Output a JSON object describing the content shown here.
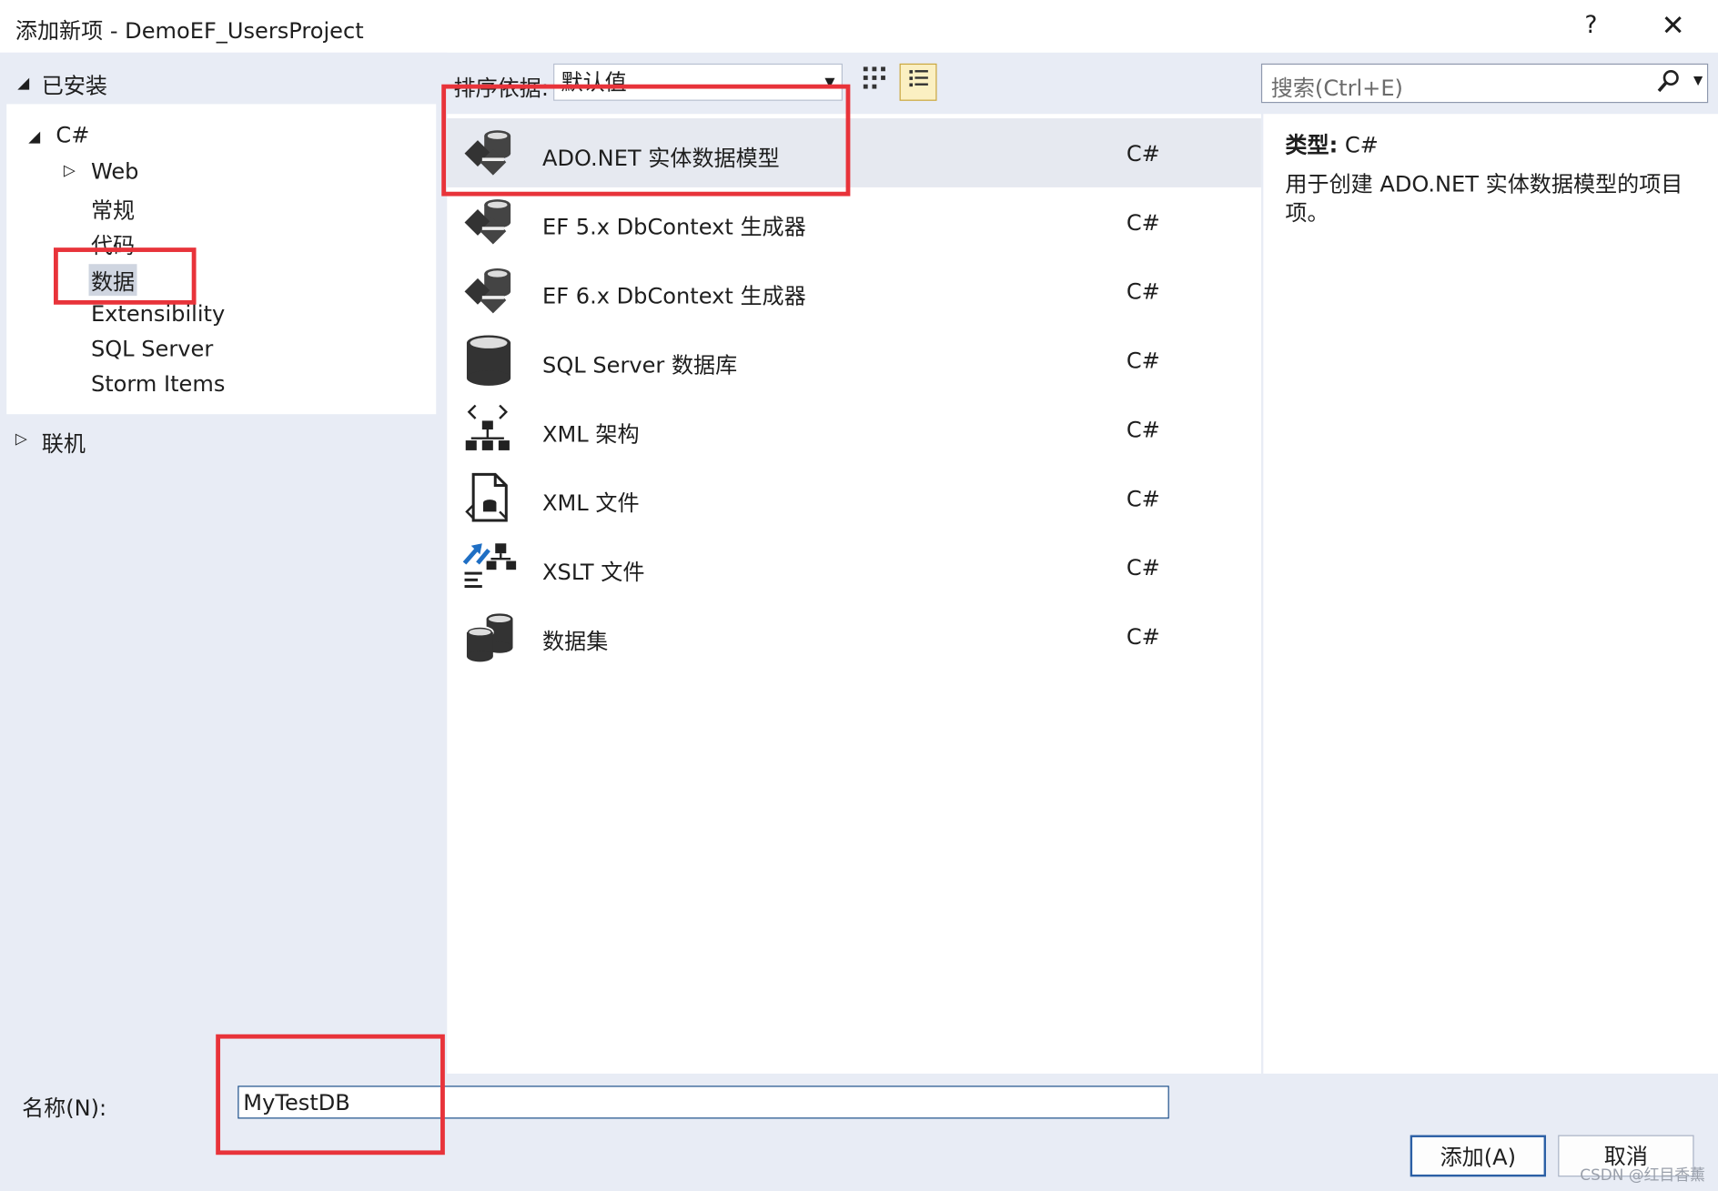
{
  "window": {
    "title": "添加新项 - DemoEF_UsersProject",
    "help": "?",
    "close": "✕"
  },
  "tree": {
    "installed": "已安装",
    "csharp": "C#",
    "web": "Web",
    "general": "常规",
    "code": "代码",
    "data": "数据",
    "extensibility": "Extensibility",
    "sqlserver": "SQL Server",
    "storm": "Storm Items",
    "online": "联机"
  },
  "toolbar": {
    "sort_label": "排序依据:",
    "sort_value": "默认值"
  },
  "search": {
    "placeholder": "搜索(Ctrl+E)"
  },
  "templates": [
    {
      "name": "ADO.NET 实体数据模型",
      "lang": "C#",
      "icon": "entity-model-icon"
    },
    {
      "name": "EF 5.x DbContext 生成器",
      "lang": "C#",
      "icon": "entity-model-icon"
    },
    {
      "name": "EF 6.x DbContext 生成器",
      "lang": "C#",
      "icon": "entity-model-icon"
    },
    {
      "name": "SQL Server 数据库",
      "lang": "C#",
      "icon": "database-icon"
    },
    {
      "name": "XML 架构",
      "lang": "C#",
      "icon": "xml-schema-icon"
    },
    {
      "name": "XML 文件",
      "lang": "C#",
      "icon": "xml-file-icon"
    },
    {
      "name": "XSLT 文件",
      "lang": "C#",
      "icon": "xslt-file-icon"
    },
    {
      "name": "数据集",
      "lang": "C#",
      "icon": "dataset-icon"
    }
  ],
  "detail": {
    "type_label": "类型:",
    "type_value": "C#",
    "description": "用于创建 ADO.NET 实体数据模型的项目项。"
  },
  "footer": {
    "name_label": "名称(N):",
    "name_value": "MyTestDB",
    "add_button": "添加(A)",
    "cancel_button": "取消"
  },
  "watermark": "CSDN @红目香薰"
}
